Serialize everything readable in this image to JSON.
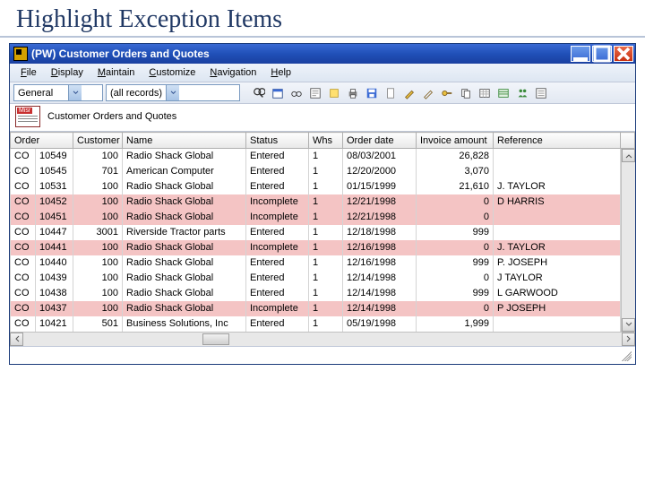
{
  "slide": {
    "title": "Highlight Exception Items"
  },
  "titlebar": {
    "title": "(PW) Customer Orders and Quotes"
  },
  "menu": {
    "file": "File",
    "display": "Display",
    "maintain": "Maintain",
    "customize": "Customize",
    "navigation": "Navigation",
    "help": "Help"
  },
  "toolbar": {
    "view_combo": "General",
    "filter_combo": "(all records)"
  },
  "subheader": {
    "label": "Customer Orders and Quotes"
  },
  "columns": {
    "order": "Order",
    "customer": "Customer",
    "name": "Name",
    "status": "Status",
    "whs": "Whs",
    "orderdate": "Order date",
    "invamt": "Invoice amount",
    "reference": "Reference"
  },
  "rows": [
    {
      "type": "CO",
      "no": "10549",
      "cust": "100",
      "name": "Radio Shack Global",
      "status": "Entered",
      "whs": "1",
      "date": "08/03/2001",
      "amt": "26,828",
      "ref": "",
      "hl": false
    },
    {
      "type": "CO",
      "no": "10545",
      "cust": "701",
      "name": "American Computer",
      "status": "Entered",
      "whs": "1",
      "date": "12/20/2000",
      "amt": "3,070",
      "ref": "",
      "hl": false
    },
    {
      "type": "CO",
      "no": "10531",
      "cust": "100",
      "name": "Radio Shack Global",
      "status": "Entered",
      "whs": "1",
      "date": "01/15/1999",
      "amt": "21,610",
      "ref": "J. TAYLOR",
      "hl": false
    },
    {
      "type": "CO",
      "no": "10452",
      "cust": "100",
      "name": "Radio Shack Global",
      "status": "Incomplete",
      "whs": "1",
      "date": "12/21/1998",
      "amt": "0",
      "ref": "D HARRIS",
      "hl": true
    },
    {
      "type": "CO",
      "no": "10451",
      "cust": "100",
      "name": "Radio Shack Global",
      "status": "Incomplete",
      "whs": "1",
      "date": "12/21/1998",
      "amt": "0",
      "ref": "",
      "hl": true
    },
    {
      "type": "CO",
      "no": "10447",
      "cust": "3001",
      "name": "Riverside Tractor parts",
      "status": "Entered",
      "whs": "1",
      "date": "12/18/1998",
      "amt": "999",
      "ref": "",
      "hl": false
    },
    {
      "type": "CO",
      "no": "10441",
      "cust": "100",
      "name": "Radio Shack Global",
      "status": "Incomplete",
      "whs": "1",
      "date": "12/16/1998",
      "amt": "0",
      "ref": "J. TAYLOR",
      "hl": true
    },
    {
      "type": "CO",
      "no": "10440",
      "cust": "100",
      "name": "Radio Shack Global",
      "status": "Entered",
      "whs": "1",
      "date": "12/16/1998",
      "amt": "999",
      "ref": "P. JOSEPH",
      "hl": false
    },
    {
      "type": "CO",
      "no": "10439",
      "cust": "100",
      "name": "Radio Shack Global",
      "status": "Entered",
      "whs": "1",
      "date": "12/14/1998",
      "amt": "0",
      "ref": "J TAYLOR",
      "hl": false
    },
    {
      "type": "CO",
      "no": "10438",
      "cust": "100",
      "name": "Radio Shack Global",
      "status": "Entered",
      "whs": "1",
      "date": "12/14/1998",
      "amt": "999",
      "ref": "L GARWOOD",
      "hl": false
    },
    {
      "type": "CO",
      "no": "10437",
      "cust": "100",
      "name": "Radio Shack Global",
      "status": "Incomplete",
      "whs": "1",
      "date": "12/14/1998",
      "amt": "0",
      "ref": "P JOSEPH",
      "hl": true
    },
    {
      "type": "CO",
      "no": "10421",
      "cust": "501",
      "name": "Business Solutions, Inc",
      "status": "Entered",
      "whs": "1",
      "date": "05/19/1998",
      "amt": "1,999",
      "ref": "",
      "hl": false
    }
  ]
}
